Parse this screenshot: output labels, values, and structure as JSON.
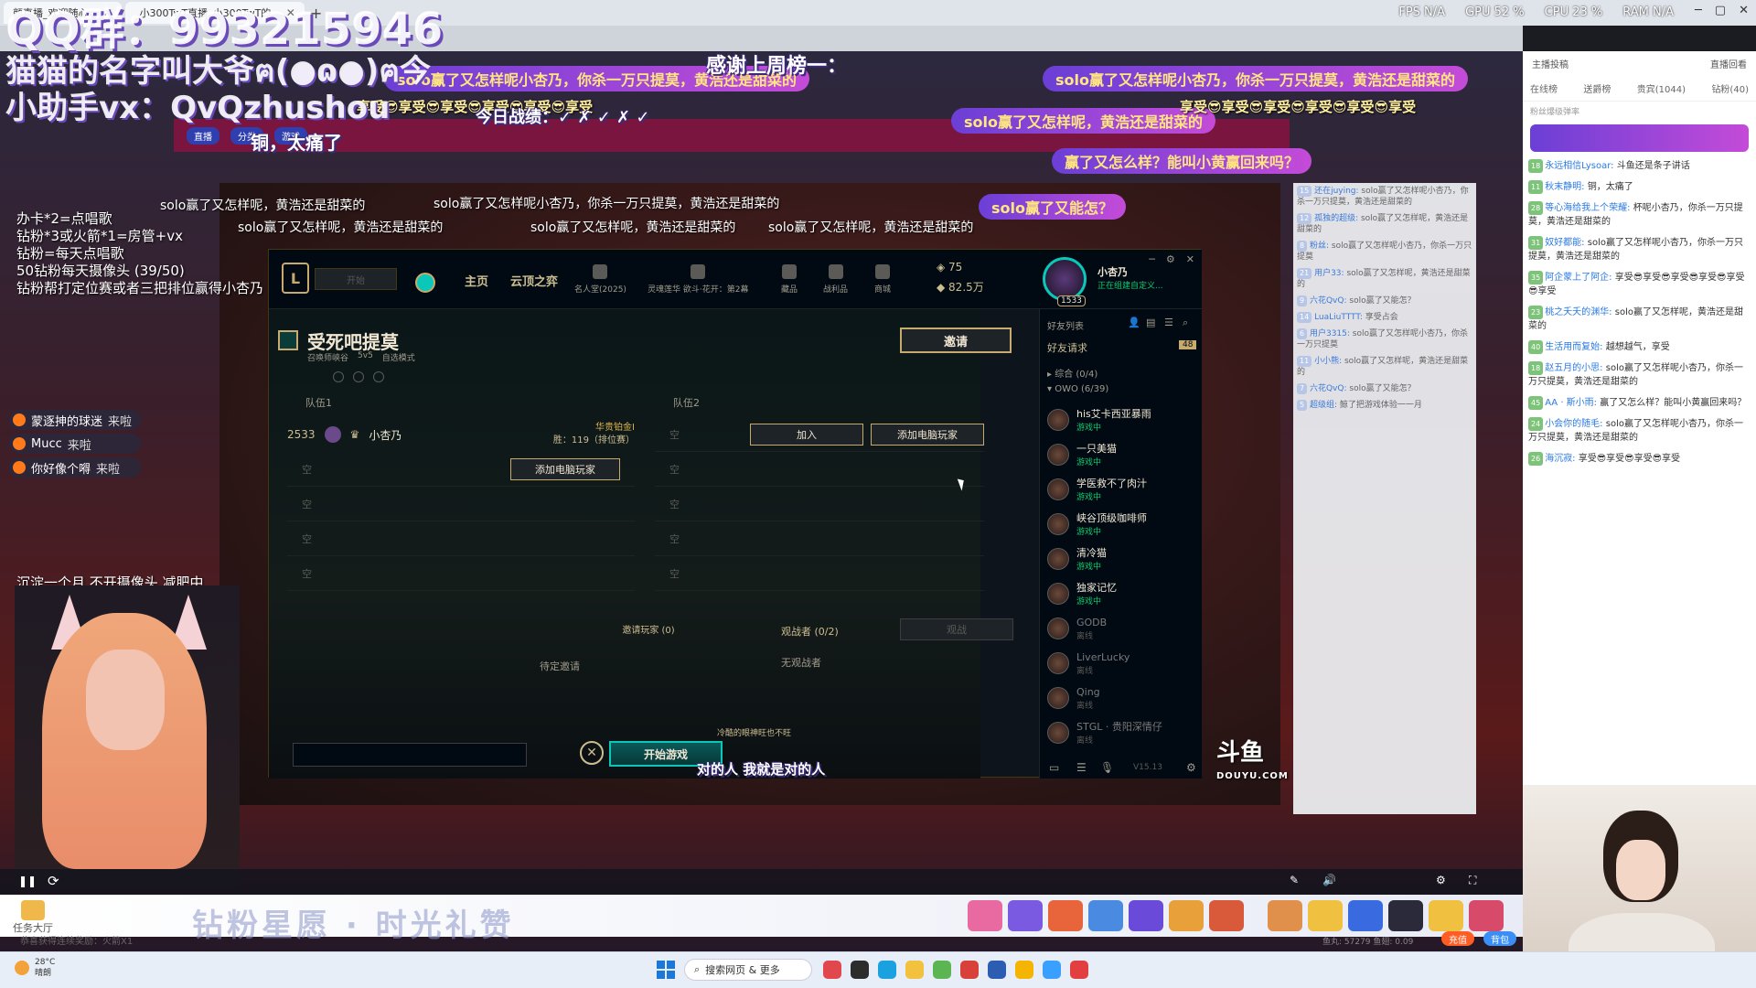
{
  "browser": {
    "tabs": [
      {
        "title": "颜直播_欢迎随心..."
      },
      {
        "title": "_小300TwT直播_小300TwT的..."
      }
    ],
    "new_tab": "+",
    "perf": {
      "fps": "FPS N/A",
      "gpu": "GPU 52 %",
      "cpu": "CPU 23 %",
      "ram": "RAM N/A"
    }
  },
  "overlay": {
    "qq_group": "QQ群：993215946",
    "cat_name": "猫猫的名字叫大爷ฅ(●ɷ●)ฅ今",
    "assistant": "小助手vx：QvQzhushou",
    "thanks_title": "感谢上周榜一：",
    "today_record": "今日战绩：✓ ✗ ✓ ✗ ✓",
    "ouch": "铜，太痛了",
    "rules": [
      "办卡*2=点唱歌",
      "钻粉*3或火箭*1=房管+vx",
      "钻粉=每天点唱歌",
      "50钻粉每天摄像头 (39/50)",
      "钻粉帮打定位赛或者三把排位赢得小杏乃"
    ],
    "diet_note": "沉淀一个月 不开摄像头 减肥中",
    "bottom_caption": "对的人 我就是对的人",
    "cold_eye": "冷酷的眼神旺也不旺"
  },
  "danmu": [
    "solo赢了又怎样呢小杏乃，你杀一万只提莫，黄浩还是甜菜的",
    "solo赢了又怎样呢，黄浩还是甜菜的",
    "赢了又怎么样？能叫小黄赢回来吗？",
    "solo赢了又能怎？",
    "享受😎享受😎享受😎享受😎享受😎享受"
  ],
  "enters": [
    {
      "name": "蒙逐抻的球迷",
      "verb": "来啦"
    },
    {
      "name": "Mucc",
      "verb": "来啦"
    },
    {
      "name": "你好像个嘚",
      "verb": "来啦"
    }
  ],
  "client": {
    "nav": {
      "home": "主页",
      "tft": "云顶之弈",
      "sub": [
        {
          "label": "名人堂(2025)"
        },
        {
          "label": "灵魂莲华 欲斗·花开：第2幕"
        },
        {
          "label": "藏品"
        },
        {
          "label": "战利品"
        },
        {
          "label": "商城"
        }
      ],
      "rp": "75",
      "be": "82.5万",
      "profile_name": "小杏乃",
      "profile_status": "正在组建自定义...",
      "level": "1533"
    },
    "lobby": {
      "title": "受死吧提莫",
      "map": "召唤师峡谷",
      "size": "5v5",
      "mode": "自选模式",
      "invite": "邀请",
      "team1": "队伍1",
      "team2": "队伍2",
      "me": {
        "level": "2533",
        "name": "小杏乃",
        "rank": "华贵铂金I",
        "wins": "胜：119（排位赛）"
      },
      "empty": "空",
      "join": "加入",
      "add_bot": "添加电脑玩家",
      "invited_players": "邀请玩家 (0)",
      "pending": "待定邀请",
      "spectators": "观战者 (0/2)",
      "spectate_btn": "观战",
      "no_spectators": "无观战者",
      "start": "开始游戏"
    },
    "friends": {
      "title": "好友列表",
      "requests": "好友请求",
      "request_count": "48",
      "group_general": "综合 (0/4)",
      "group_owo": "OWO (6/39)",
      "list": [
        {
          "name": "his艾卡西亚暴雨",
          "status": "游戏中",
          "online": true
        },
        {
          "name": "一只美猫",
          "status": "游戏中",
          "online": true
        },
        {
          "name": "学医救不了肉汁",
          "status": "游戏中",
          "online": true
        },
        {
          "name": "峡谷顶级咖啡师",
          "status": "游戏中",
          "online": true
        },
        {
          "name": "清冷猫",
          "status": "游戏中",
          "online": true
        },
        {
          "name": "独家记忆",
          "status": "游戏中",
          "online": true
        },
        {
          "name": "GODB",
          "status": "离线",
          "online": false
        },
        {
          "name": "LiverLucky",
          "status": "离线",
          "online": false
        },
        {
          "name": "Qing",
          "status": "离线",
          "online": false
        },
        {
          "name": "STGL · 贵阳深情仔",
          "status": "离线",
          "online": false
        }
      ],
      "version": "V15.13"
    }
  },
  "chat_col": [
    {
      "lv": "15",
      "nick": "还在juying:",
      "text": "solo赢了又怎样呢小杏乃，你杀一万只提莫，黄浩还是甜菜的"
    },
    {
      "lv": "12",
      "nick": "孤独的超级:",
      "text": "solo赢了又怎样呢，黄浩还是甜菜的"
    },
    {
      "lv": "8",
      "nick": "粉丝:",
      "text": "solo赢了又怎样呢小杏乃，你杀一万只提莫"
    },
    {
      "lv": "21",
      "nick": "用户33:",
      "text": "solo赢了又怎样呢，黄浩还是甜菜的"
    },
    {
      "lv": "9",
      "nick": "六花QvQ:",
      "text": "solo赢了又能怎？"
    },
    {
      "lv": "14",
      "nick": "LuaLiuTTTT:",
      "text": "享受占会"
    },
    {
      "lv": "6",
      "nick": "用户3315:",
      "text": "solo赢了又怎样呢小杏乃，你杀一万只提莫"
    },
    {
      "lv": "11",
      "nick": "小小熊:",
      "text": "solo赢了又怎样呢，黄浩还是甜菜的"
    },
    {
      "lv": "7",
      "nick": "六花QvQ:",
      "text": "solo赢了又能怎？"
    },
    {
      "lv": "5",
      "nick": "超级组:",
      "text": "鲸了把游戏体验一一月"
    }
  ],
  "sidebar": {
    "tabs": [
      "在线榜",
      "送爵榜",
      "贵宾(1044)",
      "钻粉(40)"
    ],
    "top_links": [
      "主播投稿",
      "直播回看"
    ],
    "notice": "粉丝爆级弹率",
    "chats": [
      {
        "lv": "18",
        "nick": "永远相信Lysoar:",
        "text": "斗鱼还是条子讲话"
      },
      {
        "lv": "11",
        "nick": "秋末静明:",
        "text": "铜，太痛了"
      },
      {
        "lv": "28",
        "nick": "等心海给我上个荣耀:",
        "text": "杯呢小杏乃，你杀一万只提莫，黄浩还是甜菜的"
      },
      {
        "lv": "31",
        "nick": "奴好都能:",
        "text": "solo赢了又怎样呢小杏乃，你杀一万只提莫，黄浩还是甜菜的"
      },
      {
        "lv": "35",
        "nick": "阿企蒙上了阿企:",
        "text": "享受😎享受😎享受😎享受😎享受😎享受"
      },
      {
        "lv": "23",
        "nick": "桃之夭夭的渊华:",
        "text": "solo赢了又怎样呢，黄浩还是甜菜的"
      },
      {
        "lv": "40",
        "nick": "生活用而复始:",
        "text": "越想越气，享受"
      },
      {
        "lv": "18",
        "nick": "赵五月的小思:",
        "text": "solo赢了又怎样呢小杏乃，你杀一万只提莫，黄浩还是甜菜的"
      },
      {
        "lv": "45",
        "nick": "AA · 斯小雨:",
        "text": "赢了又怎么样？能叫小黄赢回来吗？"
      },
      {
        "lv": "24",
        "nick": "小会你的随毛:",
        "text": "solo赢了又怎样呢小杏乃，你杀一万只提莫，黄浩还是甜菜的"
      },
      {
        "lv": "26",
        "nick": "海沉寂:",
        "text": "享受😎享受😎享受😎享受"
      }
    ]
  },
  "giftbar": {
    "task_hall": "任务大厅",
    "banner": "钻粉星愿 · 时光礼赞",
    "ticker": "恭喜获得连续奖励：火箭X1",
    "fish": "鱼丸: 57279   鱼翅: 0.09",
    "recharge": "充值",
    "backpack": "背包"
  },
  "taskbar": {
    "temp": "28°C",
    "weather": "晴朗",
    "search": "搜索网页 & 更多"
  },
  "douyu": {
    "brand": "斗鱼",
    "domain": "DOUYU.COM"
  },
  "colors": {
    "gold": "#c8aa6e",
    "teal": "#0ac8b9",
    "online": "#0acb6f",
    "danmu_banner": "#6b3fd6"
  }
}
